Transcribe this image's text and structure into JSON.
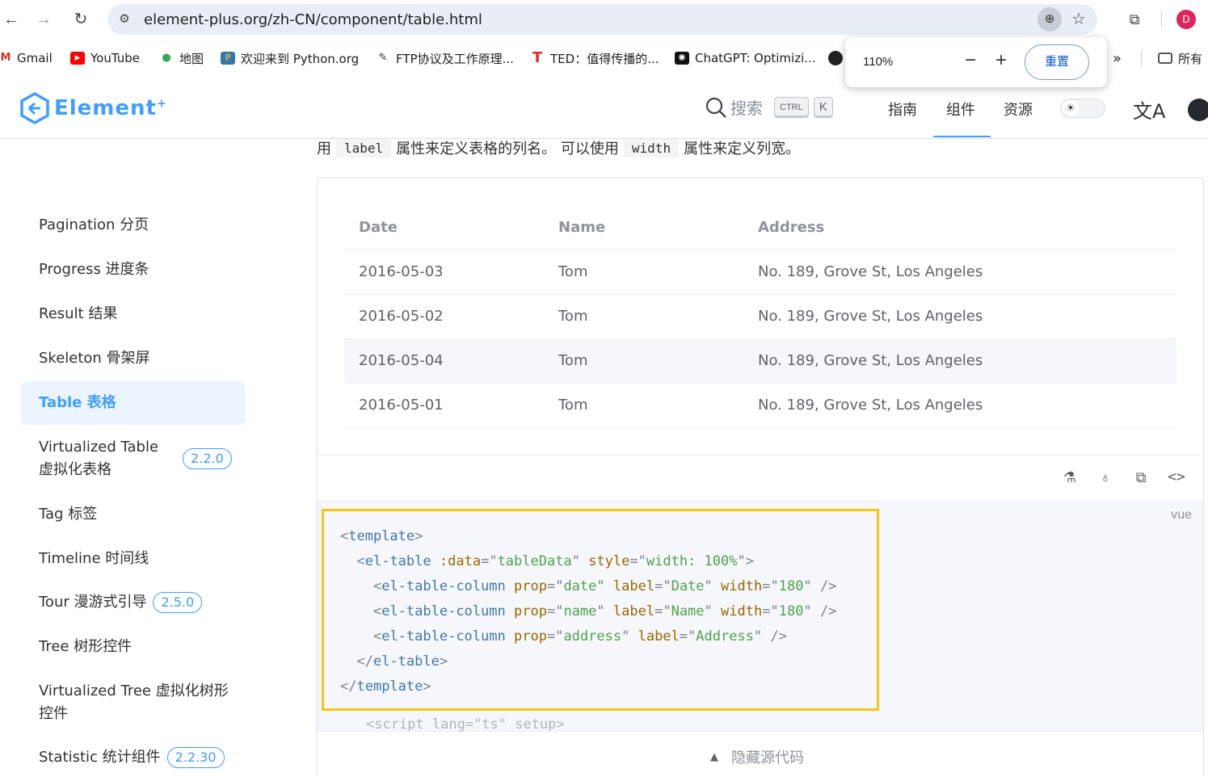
{
  "browser": {
    "url": "element-plus.org/zh-CN/component/table.html",
    "profile_initial": "D",
    "zoom_popup": {
      "level": "110%",
      "reset_label": "重置"
    },
    "bookmarks": [
      {
        "label": "Gmail",
        "icon": "gmail-icon"
      },
      {
        "label": "YouTube",
        "icon": "youtube-icon"
      },
      {
        "label": "地图",
        "icon": "maps-icon"
      },
      {
        "label": "欢迎来到 Python.org",
        "icon": "python-icon"
      },
      {
        "label": "FTP协议及工作原理...",
        "icon": "ftp-icon"
      },
      {
        "label": "TED：值得传播的...",
        "icon": "ted-icon"
      },
      {
        "label": "ChatGPT: Optimizi...",
        "icon": "chatgpt-icon"
      },
      {
        "label": "所有",
        "icon": "folder-icon"
      }
    ],
    "more_bookmarks": "»"
  },
  "site": {
    "logo_text": "Element",
    "logo_sup": "+",
    "search_label": "搜索",
    "kbd_ctrl": "CTRL",
    "kbd_k": "K",
    "nav": [
      "指南",
      "组件",
      "资源"
    ],
    "active_nav": "组件",
    "translate_icon": "文A"
  },
  "sidebar": {
    "items": [
      {
        "label": "Pagination 分页",
        "badge": ""
      },
      {
        "label": "Progress 进度条",
        "badge": ""
      },
      {
        "label": "Result 结果",
        "badge": ""
      },
      {
        "label": "Skeleton 骨架屏",
        "badge": ""
      },
      {
        "label": "Table 表格",
        "badge": "",
        "active": true
      },
      {
        "label": "Virtualized Table",
        "label2": "虚拟化表格",
        "badge": "2.2.0"
      },
      {
        "label": "Tag 标签",
        "badge": ""
      },
      {
        "label": "Timeline 时间线",
        "badge": ""
      },
      {
        "label": "Tour 漫游式引导",
        "badge": "2.5.0"
      },
      {
        "label": "Tree 树形控件",
        "badge": ""
      },
      {
        "label": "Virtualized Tree 虚拟化树形",
        "label2": "控件",
        "badge": ""
      },
      {
        "label": "Statistic 统计组件",
        "badge": "2.2.30"
      }
    ]
  },
  "content": {
    "desc": {
      "part1": "用",
      "code1": "label",
      "part2": "属性来定义表格的列名。 可以使用",
      "code2": "width",
      "part3": "属性来定义列宽。"
    },
    "table": {
      "headers": [
        "Date",
        "Name",
        "Address"
      ],
      "rows": [
        [
          "2016-05-03",
          "Tom",
          "No. 189, Grove St, Los Angeles"
        ],
        [
          "2016-05-02",
          "Tom",
          "No. 189, Grove St, Los Angeles"
        ],
        [
          "2016-05-04",
          "Tom",
          "No. 189, Grove St, Los Angeles"
        ],
        [
          "2016-05-01",
          "Tom",
          "No. 189, Grove St, Los Angeles"
        ]
      ]
    },
    "code_lang": "vue",
    "hide_source_label": "隐藏源代码"
  }
}
